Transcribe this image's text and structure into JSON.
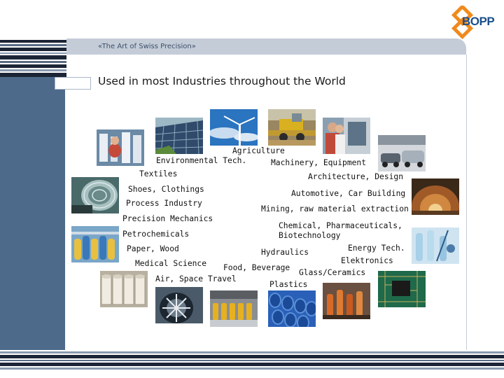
{
  "brand": {
    "logo_text": "BOPP",
    "accent": "#f08a1c",
    "navy": "#1a4f8a"
  },
  "header": {
    "tagline": "«The Art of Swiss Precision»"
  },
  "slide": {
    "title": "Used in most Industries throughout the World"
  },
  "industries_left": [
    "Agriculture",
    "Environmental Tech.",
    "Textiles",
    "Shoes, Clothings",
    "Process Industry",
    "Precision Mechanics",
    "Petrochemicals",
    "Paper, Wood",
    "Medical Science",
    "Air, Space Travel"
  ],
  "industries_right": [
    "Machinery, Equipment",
    "Architecture, Design",
    "Automotive, Car Building",
    "Mining, raw material extraction",
    "Chemical, Pharmaceuticals,",
    "Biotechnology",
    "Hydraulics",
    "Energy Tech.",
    "Elektronics",
    "Food, Beverage",
    "Glass/Ceramics",
    "Plastics"
  ],
  "photos": [
    "textile-photo",
    "solar-photo",
    "wind-turbine-photo",
    "harvester-photo",
    "machinery-photo",
    "car-factory-photo",
    "mine-tunnel-photo",
    "lab-vials-photo",
    "circuit-board-photo",
    "glass-bottles-photo",
    "pipes-photo",
    "beverage-line-photo",
    "aircraft-engine-photo",
    "paper-rolls-photo",
    "process-plant-photo",
    "precision-parts-photo"
  ]
}
